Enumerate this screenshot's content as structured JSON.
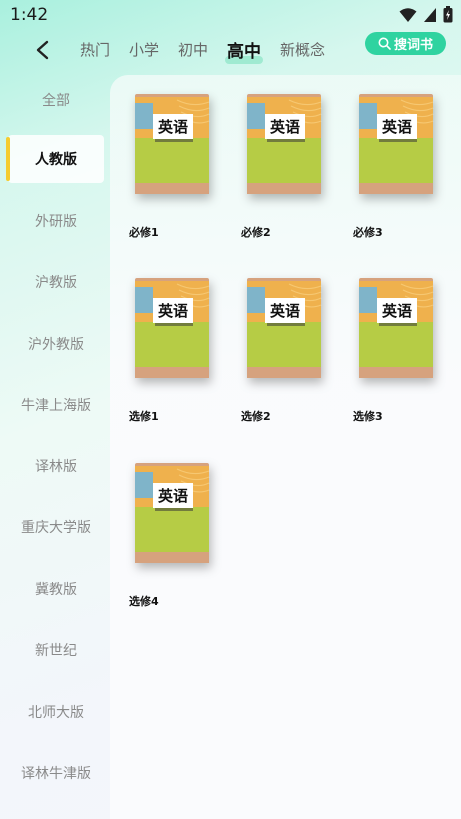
{
  "status": {
    "time": "1:42"
  },
  "header": {
    "tabs": [
      {
        "label": "热门"
      },
      {
        "label": "小学"
      },
      {
        "label": "初中"
      },
      {
        "label": "高中",
        "active": true
      },
      {
        "label": "新概念"
      }
    ],
    "search_label": "搜词书"
  },
  "sidebar": {
    "items": [
      {
        "label": "全部"
      },
      {
        "label": "人教版",
        "active": true
      },
      {
        "label": "外研版"
      },
      {
        "label": "沪教版"
      },
      {
        "label": "沪外教版"
      },
      {
        "label": "牛津上海版"
      },
      {
        "label": "译林版"
      },
      {
        "label": "重庆大学版"
      },
      {
        "label": "冀教版"
      },
      {
        "label": "新世纪"
      },
      {
        "label": "北师大版"
      },
      {
        "label": "译林牛津版"
      }
    ]
  },
  "books": [
    {
      "cover_text": "英语",
      "title": "必修1"
    },
    {
      "cover_text": "英语",
      "title": "必修2"
    },
    {
      "cover_text": "英语",
      "title": "必修3"
    },
    {
      "cover_text": "英语",
      "title": "选修1"
    },
    {
      "cover_text": "英语",
      "title": "选修2"
    },
    {
      "cover_text": "英语",
      "title": "选修3"
    },
    {
      "cover_text": "英语",
      "title": "选修4"
    }
  ],
  "colors": {
    "accent": "#2fd3a0",
    "sidebar_marker": "#f5cc2f",
    "cover_orange": "#efb14d",
    "cover_green": "#b6cc44",
    "cover_blue": "#7fb4c9",
    "cover_spine": "#d6a27e"
  }
}
